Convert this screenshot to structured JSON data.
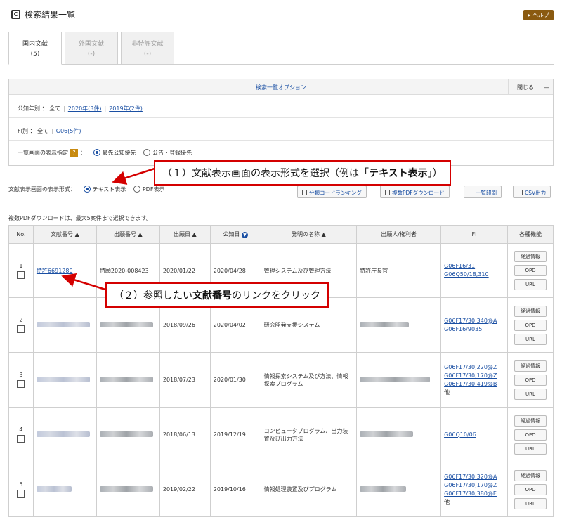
{
  "header": {
    "title": "検索結果一覧",
    "help": "▸ ヘルプ"
  },
  "tabs": [
    {
      "label": "国内文献",
      "count": "(5)"
    },
    {
      "label": "外国文献",
      "count": "(-)"
    },
    {
      "label": "非特許文献",
      "count": "(-)"
    }
  ],
  "options": {
    "title": "検索一覧オプション",
    "close": "閉じる",
    "close_icon": "—",
    "year_label": "公知年別 ： 全て",
    "year_links": [
      "2020年(3件)",
      "2019年(2件)"
    ],
    "fi_label": "FI別 ： 全て",
    "fi_links": [
      "G06(5件)"
    ],
    "order_label": "一覧画面の表示指定",
    "order_colon": "：",
    "order_options": [
      "最先公知優先",
      "公告・登録優先"
    ]
  },
  "format": {
    "label": "文献表示画面の表示形式：",
    "options": [
      "テキスト表示",
      "PDF表示"
    ]
  },
  "toolbar": [
    "分類コードランキング",
    "複数PDFダウンロード",
    "一覧印刷",
    "CSV出力"
  ],
  "note": "複数PDFダウンロードは、最大5案件まで選択できます。",
  "table": {
    "headers": [
      "No.",
      "文献番号 ▲",
      "出願番号 ▲",
      "出願日 ▲",
      "公知日",
      "発明の名称 ▲",
      "出願人/権利者",
      "FI",
      "各種機能"
    ],
    "rows": [
      {
        "no": "1",
        "doc": "特許6691280",
        "app_no": "特願2020-008423",
        "app_date": "2020/01/22",
        "pub_date": "2020/04/28",
        "title": "管理システム及び管理方法",
        "applicant": "特許庁長官",
        "fi": [
          "G06F16/31",
          "G06Q50/18,310"
        ],
        "fi_more": ""
      },
      {
        "no": "2",
        "doc": "",
        "app_no": "",
        "app_date": "2018/09/26",
        "pub_date": "2020/04/02",
        "title": "研究開発支援システム",
        "applicant": "",
        "fi": [
          "G06F17/30,340@A",
          "G06F16/9035"
        ],
        "fi_more": ""
      },
      {
        "no": "3",
        "doc": "",
        "app_no": "",
        "app_date": "2018/07/23",
        "pub_date": "2020/01/30",
        "title": "情報探索システム及び方法、情報探索プログラム",
        "applicant": "",
        "fi": [
          "G06F17/30,220@Z",
          "G06F17/30,170@Z",
          "G06F17/30,419@B"
        ],
        "fi_more": "他"
      },
      {
        "no": "4",
        "doc": "",
        "app_no": "",
        "app_date": "2018/06/13",
        "pub_date": "2019/12/19",
        "title": "コンピュータプログラム、出力装置及び出力方法",
        "applicant": "",
        "fi": [
          "G06Q10/06"
        ],
        "fi_more": ""
      },
      {
        "no": "5",
        "doc": "",
        "app_no": "",
        "app_date": "2019/02/22",
        "pub_date": "2019/10/16",
        "title": "情報処理装置及びプログラム",
        "applicant": "",
        "fi": [
          "G06F17/30,320@A",
          "G06F17/30,170@Z",
          "G06F17/30,380@E"
        ],
        "fi_more": "他"
      }
    ],
    "actions": [
      "経過情報",
      "OPD",
      "URL"
    ]
  },
  "callouts": {
    "one": {
      "pre": "（１）文献表示画面の表示形式を選択（例は「",
      "bold": "テキスト表示",
      "post": "」）"
    },
    "two": {
      "pre": "（２）参照したい",
      "bold": "文献番号",
      "post": "のリンクをクリック"
    }
  },
  "colors": {
    "callout": "#d40000",
    "link": "#1a4fa3",
    "help": "#8a5a10"
  }
}
